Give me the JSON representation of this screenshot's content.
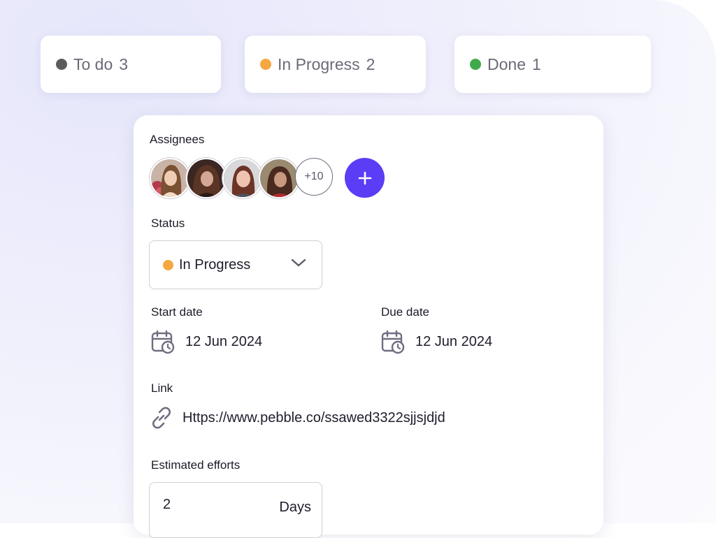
{
  "columns": [
    {
      "label": "To do",
      "count": "3",
      "color": "#5c5c5c"
    },
    {
      "label": "In Progress",
      "count": "2",
      "color": "#f5a841"
    },
    {
      "label": "Done",
      "count": "1",
      "color": "#3faa4a"
    }
  ],
  "task": {
    "assignees_label": "Assignees",
    "more_assignees": "+10",
    "add_assignee_icon": "plus-icon",
    "status_label": "Status",
    "status_value": "In Progress",
    "status_color": "#f5a841",
    "start_date_label": "Start date",
    "start_date": "12 Jun 2024",
    "due_date_label": "Due date",
    "due_date": "12 Jun 2024",
    "link_label": "Link",
    "link_url": "Https://www.pebble.co/ssawed3322sjjsjdjd",
    "efforts_label": "Estimated efforts",
    "efforts_value": "2",
    "efforts_unit": "Days"
  },
  "colors": {
    "accent": "#5b3df6",
    "text": "#1e1e2c",
    "muted": "#6b6b78"
  }
}
